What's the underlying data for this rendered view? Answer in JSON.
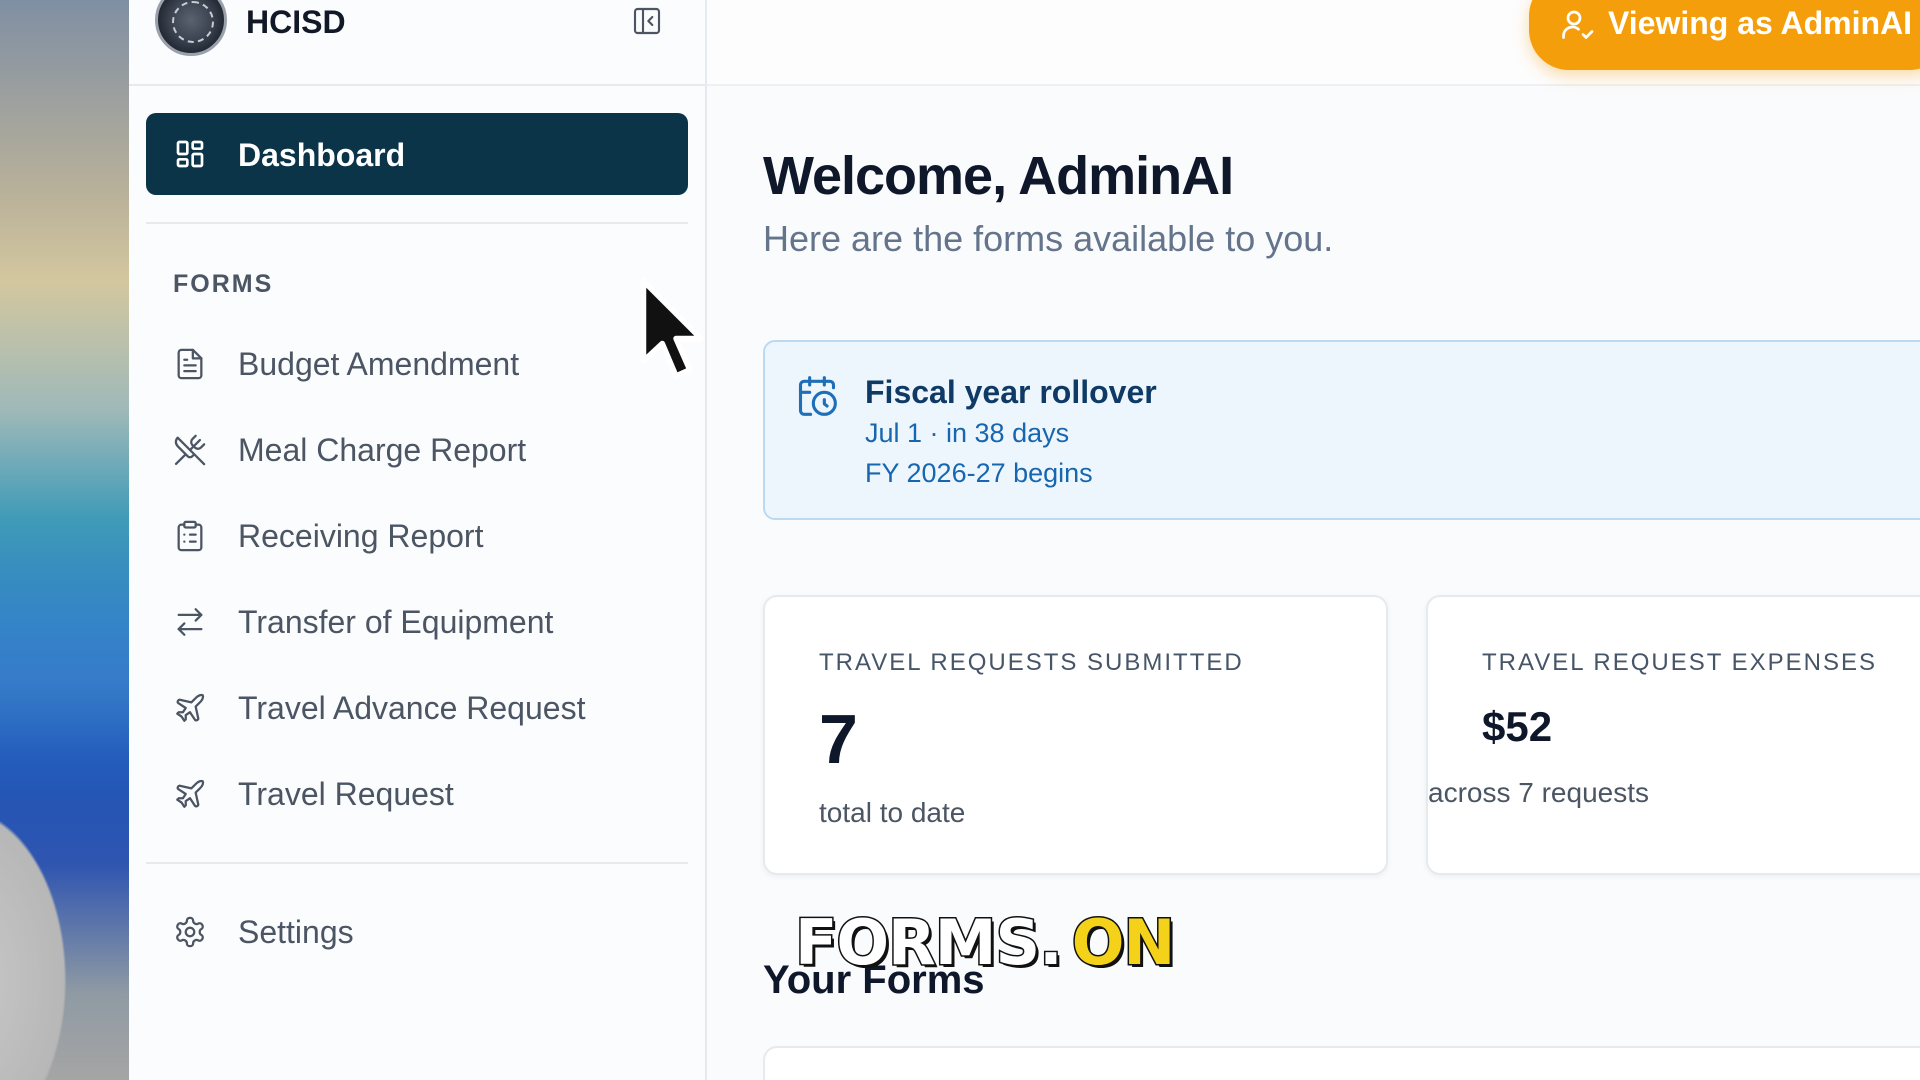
{
  "app": {
    "brand": "HCISD"
  },
  "topbar": {
    "viewing_label": "Viewing as AdminAI"
  },
  "sidebar": {
    "active": {
      "label": "Dashboard",
      "icon": "dashboard-icon"
    },
    "section_label": "FORMS",
    "items": [
      {
        "label": "Budget Amendment",
        "icon": "document-icon"
      },
      {
        "label": "Meal Charge Report",
        "icon": "utensils-crossed-icon"
      },
      {
        "label": "Receiving Report",
        "icon": "clipboard-icon"
      },
      {
        "label": "Transfer of Equipment",
        "icon": "arrows-left-right-icon"
      },
      {
        "label": "Travel Advance Request",
        "icon": "plane-icon"
      },
      {
        "label": "Travel Request",
        "icon": "plane-icon"
      }
    ],
    "settings": {
      "label": "Settings",
      "icon": "gear-icon"
    }
  },
  "main": {
    "welcome": "Welcome, AdminAI",
    "subtitle": "Here are the forms available to you.",
    "alert": {
      "title": "Fiscal year rollover",
      "line1": "Jul 1 · in 38 days",
      "line2": "FY 2026-27 begins",
      "icon": "calendar-clock-icon"
    },
    "cards": [
      {
        "caption": "TRAVEL REQUESTS SUBMITTED",
        "value": "7",
        "footer": "total to date"
      },
      {
        "caption": "TRAVEL REQUEST EXPENSES",
        "value": "$52",
        "footer": "across 7 requests"
      }
    ],
    "section_title": "Your Forms"
  },
  "overlay": {
    "caption_white": "FORMS.",
    "caption_yellow": "ON"
  },
  "colors": {
    "sidebar_active": "#0b3448",
    "badge": "#f59e0b",
    "alert_bg": "#eef6fd",
    "alert_text": "#1766b0"
  }
}
